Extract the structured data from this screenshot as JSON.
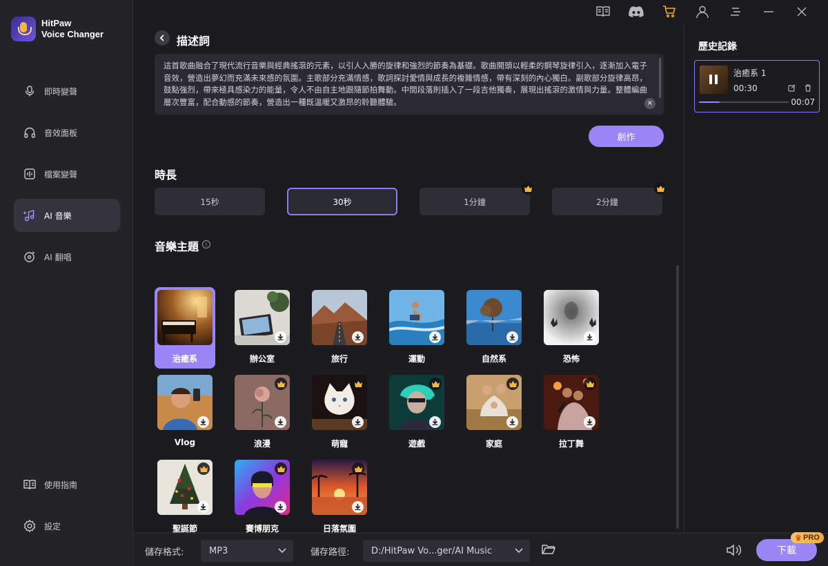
{
  "app": {
    "name_line1": "HitPaw",
    "name_line2": "Voice Changer"
  },
  "sidebar": {
    "items": [
      {
        "label": "即時變聲",
        "icon": "microphone-icon"
      },
      {
        "label": "音效面板",
        "icon": "headphones-icon"
      },
      {
        "label": "檔案變聲",
        "icon": "audio-file-icon"
      },
      {
        "label": "AI 音樂",
        "icon": "ai-music-note-icon",
        "active": true
      },
      {
        "label": "AI 翻唱",
        "icon": "vinyl-cover-icon"
      }
    ],
    "bottom_items": [
      {
        "label": "使用指南",
        "icon": "book-icon"
      },
      {
        "label": "設定",
        "icon": "gear-icon"
      }
    ]
  },
  "topbar": {
    "icons": [
      "guide-book-icon",
      "discord-icon",
      "cart-icon",
      "user-icon",
      "menu-icon",
      "minimize-icon",
      "close-icon"
    ]
  },
  "main": {
    "description_title": "描述詞",
    "description_text": "這首歌曲融合了現代流行音樂與經典搖滾的元素，以引人入勝的旋律和強烈的節奏為基礎。歌曲開頭以輕柔的鋼琴旋律引入，逐漸加入電子音效，營造出夢幻而充滿未來感的氛圍。主歌部分充滿情感，歌詞探討愛情與成長的複雜情感，帶有深刻的內心獨白。副歌部分旋律高昂，鼓點強烈，帶來極具感染力的能量，令人不由自主地跟隨節拍舞動。中間段落則插入了一段吉他獨奏，展現出搖滾的激情與力量。整體編曲層次豐富，配合動感的節奏，營造出一種既溫暖又激昂的聆聽體驗。",
    "create_button": "創作",
    "duration_title": "時長",
    "durations": [
      {
        "label": "15秒",
        "premium": false
      },
      {
        "label": "30秒",
        "premium": false,
        "selected": true
      },
      {
        "label": "1分鐘",
        "premium": true
      },
      {
        "label": "2分鐘",
        "premium": true
      }
    ],
    "theme_title": "音樂主題",
    "themes": [
      {
        "label": "治癒系",
        "selected": true,
        "premium": false
      },
      {
        "label": "辦公室",
        "premium": false
      },
      {
        "label": "旅行",
        "premium": false
      },
      {
        "label": "運動",
        "premium": false
      },
      {
        "label": "自然系",
        "premium": false
      },
      {
        "label": "恐怖",
        "premium": false
      },
      {
        "label": "Vlog",
        "premium": false
      },
      {
        "label": "浪漫",
        "premium": true
      },
      {
        "label": "萌寵",
        "premium": true
      },
      {
        "label": "遊戲",
        "premium": true
      },
      {
        "label": "家庭",
        "premium": true
      },
      {
        "label": "拉丁舞",
        "premium": true
      },
      {
        "label": "聖誕節",
        "premium": true
      },
      {
        "label": "賽博朋克",
        "premium": true
      },
      {
        "label": "日落氛圍",
        "premium": true
      }
    ]
  },
  "history": {
    "title": "歷史記錄",
    "items": [
      {
        "title": "治癒系 1",
        "duration": "00:30",
        "elapsed": "00:07",
        "progress": 0.23
      }
    ]
  },
  "bottom": {
    "format_label": "儲存格式:",
    "format_value": "MP3",
    "path_label": "儲存路徑:",
    "path_value": "D:/HitPaw Vo...ger/AI Music",
    "download_button": "下載",
    "pro_badge": "PRO"
  },
  "colors": {
    "accent": "#9a86f5",
    "accent_border": "#8f7bf0",
    "background": "#1c1c20",
    "crown": "#f5b642"
  }
}
